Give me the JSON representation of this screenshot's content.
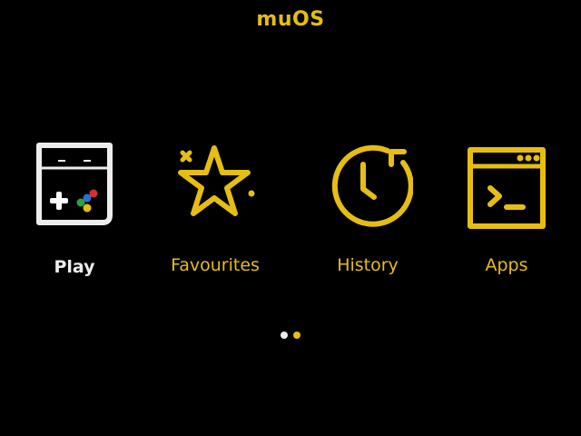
{
  "header": {
    "title": "muOS"
  },
  "menu": {
    "items": [
      {
        "label": "Play",
        "icon": "handheld-console-icon",
        "selected": true
      },
      {
        "label": "Favourites",
        "icon": "star-icon",
        "selected": false
      },
      {
        "label": "History",
        "icon": "history-clock-icon",
        "selected": false
      },
      {
        "label": "Apps",
        "icon": "terminal-window-icon",
        "selected": false
      }
    ]
  },
  "pager": {
    "total_pages": 2,
    "current_page": 2
  },
  "colors": {
    "background": "#000000",
    "accent": "#E6BE12",
    "selected": "#EDEDED",
    "dpad_white": "#FFFFFF",
    "button_blue": "#2F6FD0",
    "button_red": "#D8302C",
    "button_green": "#2EA043",
    "button_yellow": "#E6BE12"
  }
}
